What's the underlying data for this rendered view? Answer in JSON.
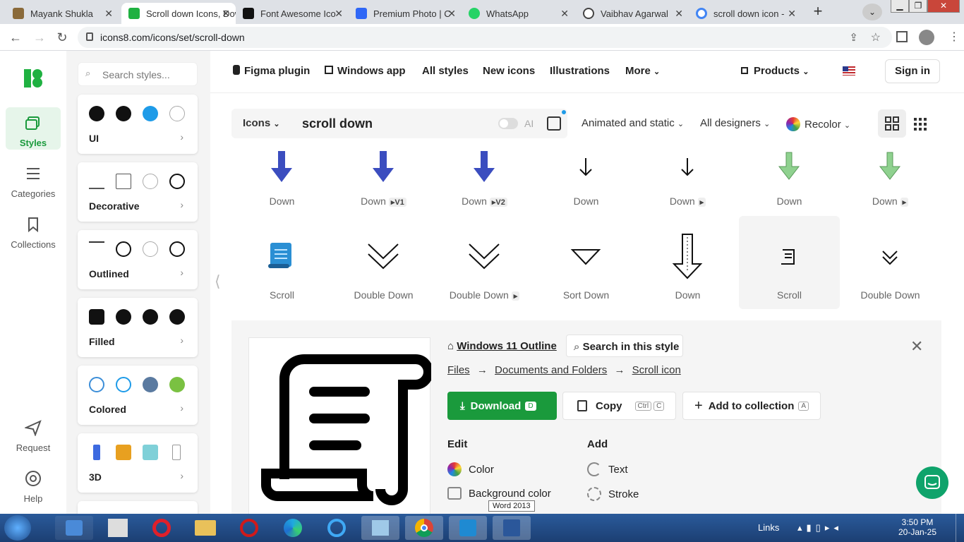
{
  "browser": {
    "tabs": [
      {
        "title": "Mayank Shukla",
        "fav": "#8a6a3a"
      },
      {
        "title": "Scroll down Icons, Downl",
        "fav": "#1fb141",
        "active": true
      },
      {
        "title": "Font Awesome Ico",
        "fav": "#111"
      },
      {
        "title": "Premium Photo | C",
        "fav": "#2f67f6"
      },
      {
        "title": "WhatsApp",
        "fav": "#25d366"
      },
      {
        "title": "Vaibhav Agarwal",
        "fav": "#444"
      },
      {
        "title": "scroll down icon -",
        "fav": "#4285f4"
      }
    ],
    "url": "icons8.com/icons/set/scroll-down"
  },
  "rail": {
    "styles": "Styles",
    "categories": "Categories",
    "collections": "Collections",
    "request": "Request",
    "help": "Help"
  },
  "panel": {
    "search_placeholder": "Search styles...",
    "cards": [
      "UI",
      "Decorative",
      "Outlined",
      "Filled",
      "Colored",
      "3D"
    ]
  },
  "nav": {
    "figma": "Figma plugin",
    "windows": "Windows app",
    "allstyles": "All styles",
    "newicons": "New icons",
    "illustrations": "Illustrations",
    "more": "More",
    "products": "Products",
    "signin": "Sign in"
  },
  "search": {
    "scope": "Icons",
    "query": "scroll down",
    "ai": "AI"
  },
  "filters": {
    "animated": "Animated and static",
    "designers": "All designers",
    "recolor": "Recolor"
  },
  "grid": {
    "row1": [
      {
        "label": "Down",
        "tag": ""
      },
      {
        "label": "Down",
        "tag": "▸V1"
      },
      {
        "label": "Down",
        "tag": "▸V2"
      },
      {
        "label": "Down",
        "tag": ""
      },
      {
        "label": "Down",
        "tag": "▸"
      },
      {
        "label": "Down",
        "tag": ""
      },
      {
        "label": "Down",
        "tag": "▸"
      }
    ],
    "row2": [
      {
        "label": "Scroll",
        "tag": ""
      },
      {
        "label": "Double Down",
        "tag": ""
      },
      {
        "label": "Double Down",
        "tag": "▸"
      },
      {
        "label": "Sort Down",
        "tag": ""
      },
      {
        "label": "Down",
        "tag": ""
      },
      {
        "label": "Scroll",
        "tag": ""
      },
      {
        "label": "Double Down",
        "tag": ""
      }
    ]
  },
  "detail": {
    "style": "Windows 11 Outline",
    "search_style": "Search in this style",
    "crumb": [
      "Files",
      "Documents and Folders",
      "Scroll icon"
    ],
    "download": "Download",
    "download_key": "D",
    "copy": "Copy",
    "copy_key1": "Ctrl",
    "copy_key2": "C",
    "add": "Add to collection",
    "add_key": "A",
    "edit": "Edit",
    "addh": "Add",
    "color": "Color",
    "bg": "Background color",
    "text": "Text",
    "stroke": "Stroke"
  },
  "taskbar": {
    "tooltip": "Word 2013",
    "links": "Links",
    "time": "3:50 PM",
    "date": "20-Jan-25"
  }
}
